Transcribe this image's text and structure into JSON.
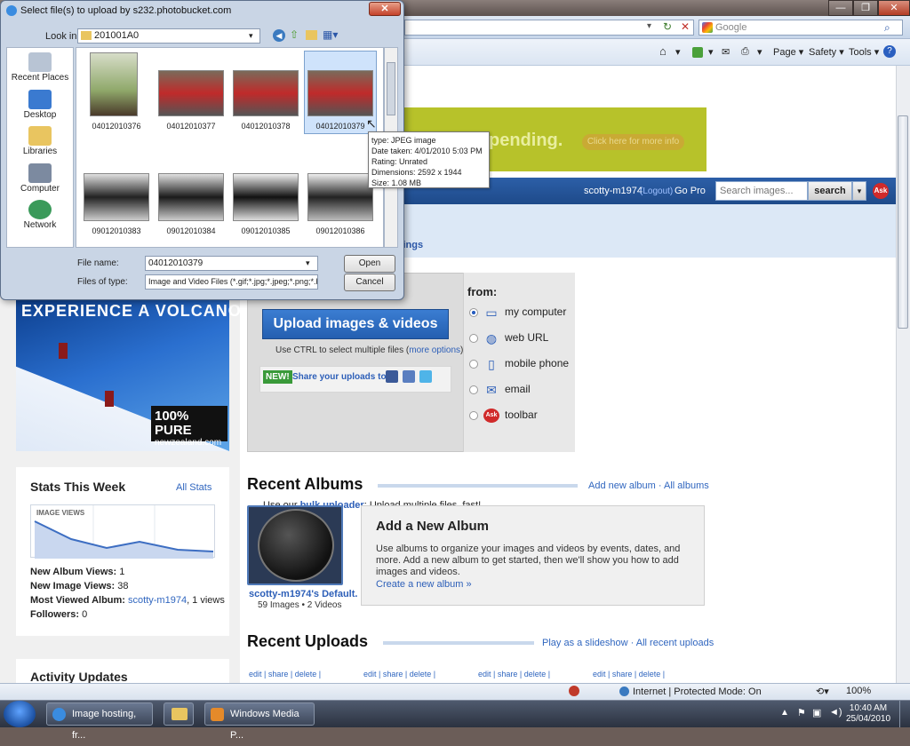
{
  "ie": {
    "search_placeholder": "Google",
    "cmd_items": [
      "Page ▾",
      "Safety ▾",
      "Tools ▾"
    ],
    "status_zone": "Internet | Protected Mode: On",
    "zoom": "100%"
  },
  "ad": {
    "banner_text": "pending.",
    "banner_button": "Click here for more info",
    "volcano_title": "EXPERIENCE A VOLCANO",
    "nz_line1": "100% PURE",
    "nz_line2": "newzealand.com"
  },
  "pb": {
    "username": "scotty-m1974",
    "logout": "(Logout)",
    "gopro": "Go Pro",
    "search_placeholder": "Search images...",
    "search_button": "search",
    "settings": "ettings"
  },
  "upload": {
    "button": "Upload images & videos",
    "hint": "Use CTRL to select multiple files (",
    "hint_link": "more options",
    "hint_close": ")",
    "new_badge": "NEW!",
    "share_text": "Share your uploads to:",
    "bulk_prefix": "Use our ",
    "bulk_link": "bulk uploader",
    "bulk_suffix": ": Upload multiple files, fast!",
    "from_label": "from:",
    "from_options": [
      {
        "label": "my computer",
        "icon": "computer-icon",
        "selected": true
      },
      {
        "label": "web URL",
        "icon": "globe-icon",
        "selected": false
      },
      {
        "label": "mobile phone",
        "icon": "phone-icon",
        "selected": false
      },
      {
        "label": "email",
        "icon": "email-icon",
        "selected": false
      },
      {
        "label": "toolbar",
        "icon": "ask-icon",
        "selected": false
      }
    ]
  },
  "stats": {
    "title": "Stats This Week",
    "all": "All Stats",
    "chart_label": "IMAGE VIEWS",
    "lines": [
      {
        "label": "New Album Views:",
        "value": "1"
      },
      {
        "label": "New Image Views:",
        "value": "38"
      },
      {
        "label": "Most Viewed Album:",
        "value": "scotty-m1974",
        "extra": ", 1 views"
      },
      {
        "label": "Followers:",
        "value": "0"
      }
    ],
    "activity_title": "Activity Updates"
  },
  "albums": {
    "title": "Recent Albums",
    "links": "Add new album · All albums",
    "album_name": "scotty-m1974's Default.",
    "album_count": "59 Images • 2 Videos",
    "new_title": "Add a New Album",
    "new_desc": "Use albums to organize your images and videos by events, dates, and more. Add a new album to get started, then we'll show you how to add images and videos.",
    "new_link": "Create a new album »"
  },
  "uploads": {
    "title": "Recent Uploads",
    "links": "Play as a slideshow · All recent uploads",
    "edit_row": "edit | share | delete |"
  },
  "taskbar": {
    "tasks": [
      "Image hosting, fr...",
      "Windows Media P..."
    ],
    "time": "10:40 AM",
    "date": "25/04/2010"
  },
  "dialog": {
    "title": "Select file(s) to upload by s232.photobucket.com",
    "lookin_label": "Look in:",
    "lookin_value": "201001A0",
    "places": [
      "Recent Places",
      "Desktop",
      "Libraries",
      "Computer",
      "Network"
    ],
    "files": [
      "04012010376",
      "04012010377",
      "04012010378",
      "04012010379",
      "09012010383",
      "09012010384",
      "09012010385",
      "09012010386"
    ],
    "tooltip": [
      "type: JPEG image",
      "Date taken: 4/01/2010 5:03 PM",
      "Rating: Unrated",
      "Dimensions: 2592 x 1944",
      "Size: 1.08 MB"
    ],
    "fname_label": "File name:",
    "fname_value": "04012010379",
    "ftype_label": "Files of type:",
    "ftype_value": "Image and Video Files (*.gif;*.jpg;*.jpeg;*.png;*.b",
    "open": "Open",
    "cancel": "Cancel"
  },
  "colors": {
    "accent": "#2d5fb8",
    "nav": "#1e4a8a",
    "ad": "#b7c22a"
  }
}
